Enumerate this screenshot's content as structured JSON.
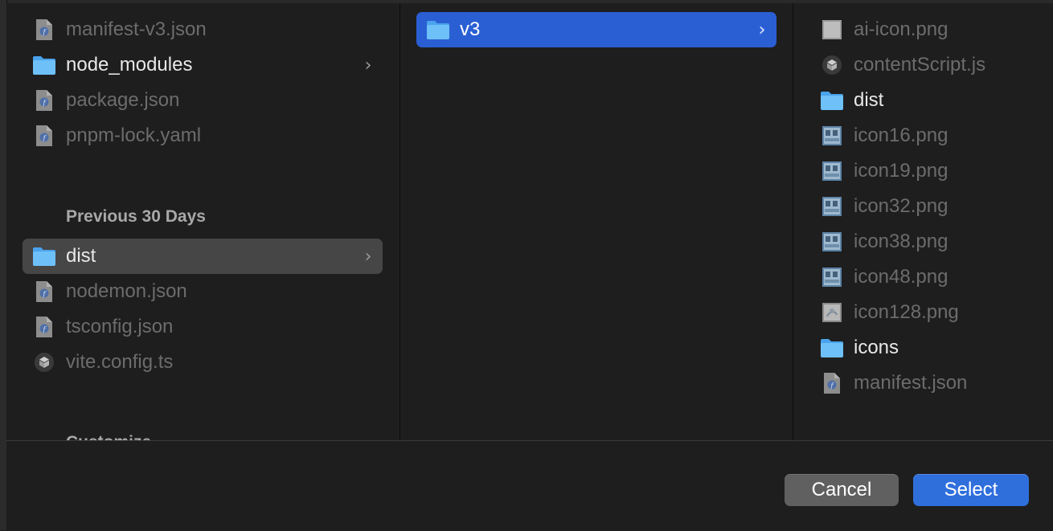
{
  "columns": [
    {
      "items": [
        {
          "label": "manifest-v3.json",
          "kind": "doc",
          "dim": true
        },
        {
          "label": "node_modules",
          "kind": "folder",
          "dim": false,
          "chevron": "›"
        },
        {
          "label": "package.json",
          "kind": "doc",
          "dim": true
        },
        {
          "label": "pnpm-lock.yaml",
          "kind": "doc",
          "dim": true
        }
      ],
      "section": "Previous 30 Days",
      "items2": [
        {
          "label": "dist",
          "kind": "folder",
          "dim": false,
          "chevron": "›",
          "selected": "gray"
        },
        {
          "label": "nodemon.json",
          "kind": "doc",
          "dim": true
        },
        {
          "label": "tsconfig.json",
          "kind": "doc",
          "dim": true
        },
        {
          "label": "vite.config.ts",
          "kind": "exec",
          "dim": true
        }
      ],
      "section_cut": "Customize"
    },
    {
      "items": [
        {
          "label": "v3",
          "kind": "folder",
          "chevron": "›",
          "selected": "blue"
        }
      ]
    },
    {
      "items": [
        {
          "label": "ai-icon.png",
          "kind": "image-blank",
          "dim": true
        },
        {
          "label": "contentScript.js",
          "kind": "exec",
          "dim": true
        },
        {
          "label": "dist",
          "kind": "folder",
          "dim": false
        },
        {
          "label": "icon16.png",
          "kind": "image-thumb",
          "dim": true
        },
        {
          "label": "icon19.png",
          "kind": "image-thumb",
          "dim": true
        },
        {
          "label": "icon32.png",
          "kind": "image-thumb",
          "dim": true
        },
        {
          "label": "icon38.png",
          "kind": "image-thumb",
          "dim": true
        },
        {
          "label": "icon48.png",
          "kind": "image-thumb",
          "dim": true
        },
        {
          "label": "icon128.png",
          "kind": "image-light",
          "dim": true
        },
        {
          "label": "icons",
          "kind": "folder",
          "dim": false
        },
        {
          "label": "manifest.json",
          "kind": "doc",
          "dim": true
        }
      ]
    }
  ],
  "footer": {
    "cancel_label": "Cancel",
    "select_label": "Select"
  },
  "colors": {
    "background": "#1e1e1e",
    "selection_blue": "#2a5fd4",
    "selection_gray": "#464646",
    "button_primary": "#2f6fdc",
    "button_secondary": "#606060",
    "folder_blue": "#5fb4f5"
  }
}
